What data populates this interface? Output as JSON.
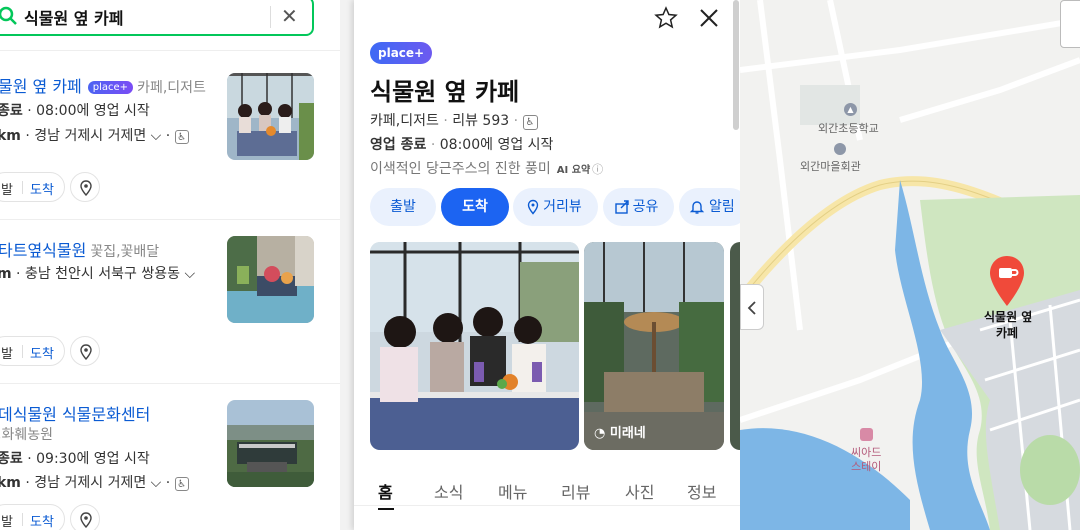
{
  "search": {
    "query": "식물원 옆 카페"
  },
  "results": [
    {
      "title": "물원 옆 카페",
      "badge": "place+",
      "category": "카페,디저트",
      "status": "종료",
      "hours": "08:00에 영업 시작",
      "distance": "km",
      "address": "경남 거제시 거제면",
      "depart": "발",
      "arrive": "도착"
    },
    {
      "title": "타트옆식물원",
      "category": "꽃집,꽃배달",
      "distance": "m",
      "address": "충남 천안시 서북구 쌍용동",
      "depart": "발",
      "arrive": "도착"
    },
    {
      "title": "데식물원 식물문화센터",
      "category": ",화훼농원",
      "status": "종료",
      "hours": "09:30에 영업 시작",
      "distance": "km",
      "address": "경남 거제시 거제면",
      "depart": "발",
      "arrive": "도착"
    }
  ],
  "detail": {
    "badge": "place+",
    "title": "식물원 옆 카페",
    "category": "카페,디저트",
    "reviews": "리뷰 593",
    "status": "영업 종료",
    "hours": "08:00에 영업 시작",
    "summary": "이색적인 당근주스의 진한 풍미",
    "ai_label": "AI 요약",
    "buttons": {
      "depart": "출발",
      "arrive": "도착",
      "distance": "거리뷰",
      "share": "공유",
      "alert": "알림"
    },
    "photo_caption": "미래네",
    "tabs": [
      "홈",
      "소식",
      "메뉴",
      "리뷰",
      "사진",
      "정보"
    ]
  },
  "map": {
    "labels": {
      "school": "외간초등학교",
      "hall": "외간마을회관",
      "seaside_1": "씨아드",
      "seaside_2": "스테이",
      "pin_1": "식물원 옆",
      "pin_2": "카페"
    },
    "pin_color": "#f04a3a"
  }
}
